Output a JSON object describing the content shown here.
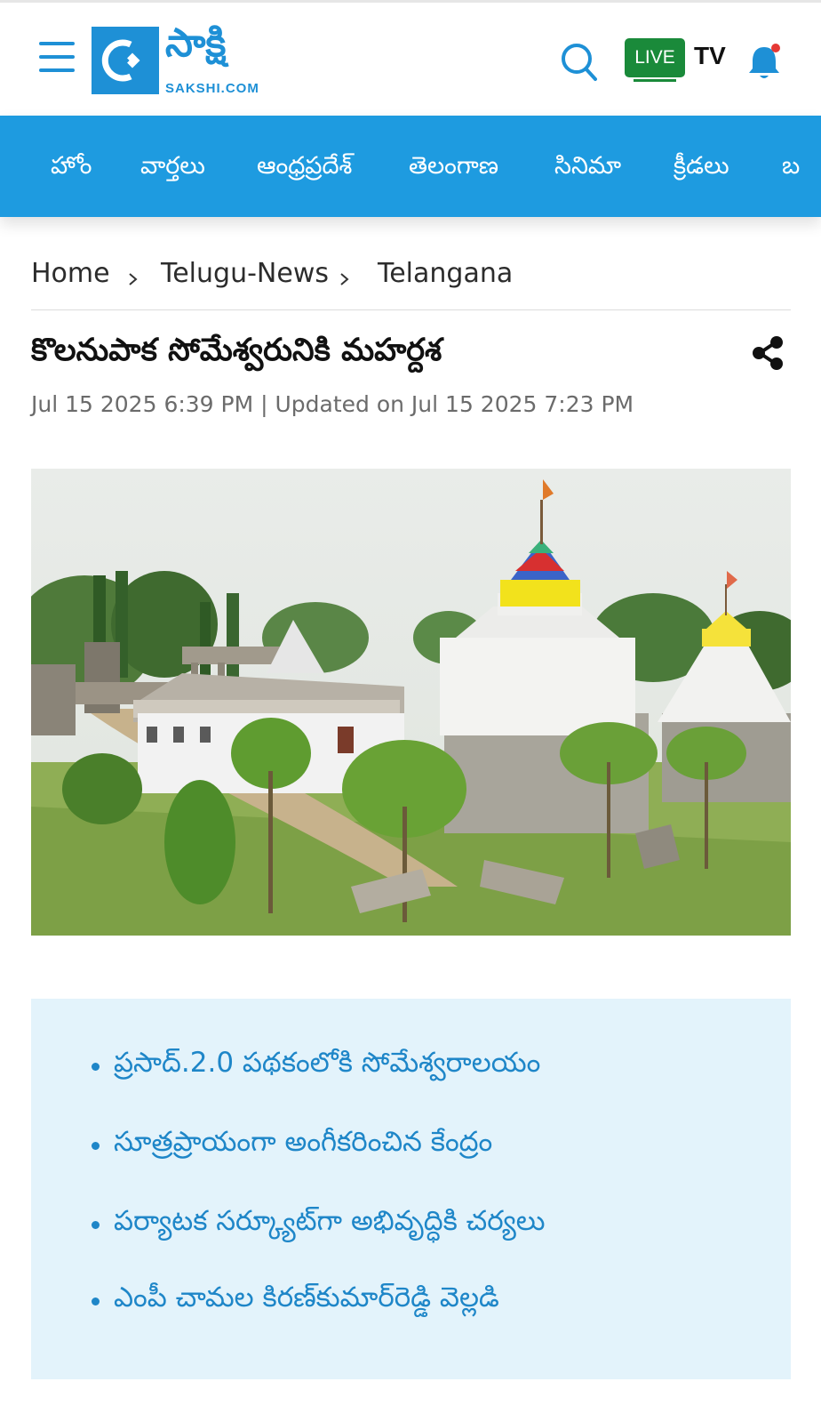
{
  "header": {
    "logo_text": "సాక్షి",
    "logo_domain": "SAKSHI.COM",
    "live_label": "LIVE",
    "tv_label": "TV",
    "colors": {
      "brand_blue": "#1e90d6",
      "nav_blue": "#1e9be0",
      "live_green": "#1a8a3a",
      "bell_dot": "#e53935"
    },
    "icons": [
      "hamburger-menu-icon",
      "search-icon",
      "bell-icon"
    ]
  },
  "nav": {
    "items": [
      "హోం",
      "వార్తలు",
      "ఆంధ్రప్రదేశ్",
      "తెలంగాణ",
      "సినిమా",
      "క్రీడలు",
      "బ"
    ]
  },
  "breadcrumb": {
    "items": [
      "Home",
      "Telugu-News",
      "Telangana"
    ]
  },
  "article": {
    "title": "కొలనుపాక సోమేశ్వరునికి మహర్దశ",
    "meta": "Jul 15 2025 6:39 PM | Updated on Jul 15 2025 7:23 PM",
    "highlights": [
      "ప్రసాద్‌.2.0 పథకంలోకి సోమేశ్వరాలయం",
      "సూత్రప్రాయంగా అంగీకరించిన కేంద్రం",
      "పర్యాటక సర్క్యూట్‌గా అభివృద్ధికి చర్యలు",
      "ఎంపీ చామల కిరణ్‌కుమార్‌రెడ్డి వెల్లడి"
    ]
  }
}
